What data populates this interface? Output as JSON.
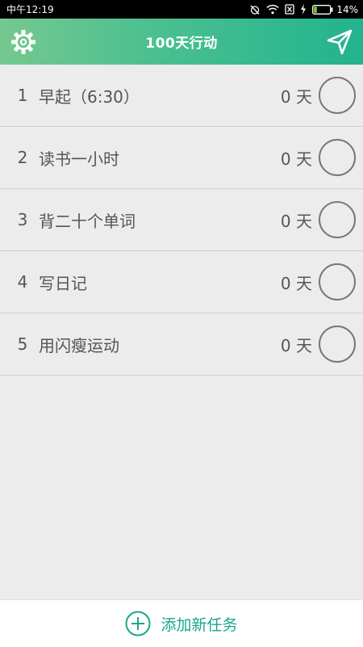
{
  "status_bar": {
    "time": "中午12:19",
    "battery_percent": "14%",
    "icons": [
      "alarm-off-icon",
      "wifi-icon",
      "sim-off-icon",
      "charging-icon",
      "battery-icon"
    ]
  },
  "app_bar": {
    "title": "100天行动",
    "left_icon": "settings-gear-icon",
    "right_icon": "send-icon"
  },
  "tasks": [
    {
      "index": "1",
      "name": "早起（6:30）",
      "days": "0 天"
    },
    {
      "index": "2",
      "name": "读书一小时",
      "days": "0 天"
    },
    {
      "index": "3",
      "name": "背二十个单词",
      "days": "0 天"
    },
    {
      "index": "4",
      "name": "写日记",
      "days": "0 天"
    },
    {
      "index": "5",
      "name": "用闪瘦运动",
      "days": "0 天"
    }
  ],
  "bottom_bar": {
    "add_label": "添加新任务",
    "add_icon": "plus-circle-icon"
  },
  "colors": {
    "accent": "#1aa58a",
    "header_start": "#74c98f",
    "header_end": "#22b38e",
    "background": "#ececec"
  }
}
